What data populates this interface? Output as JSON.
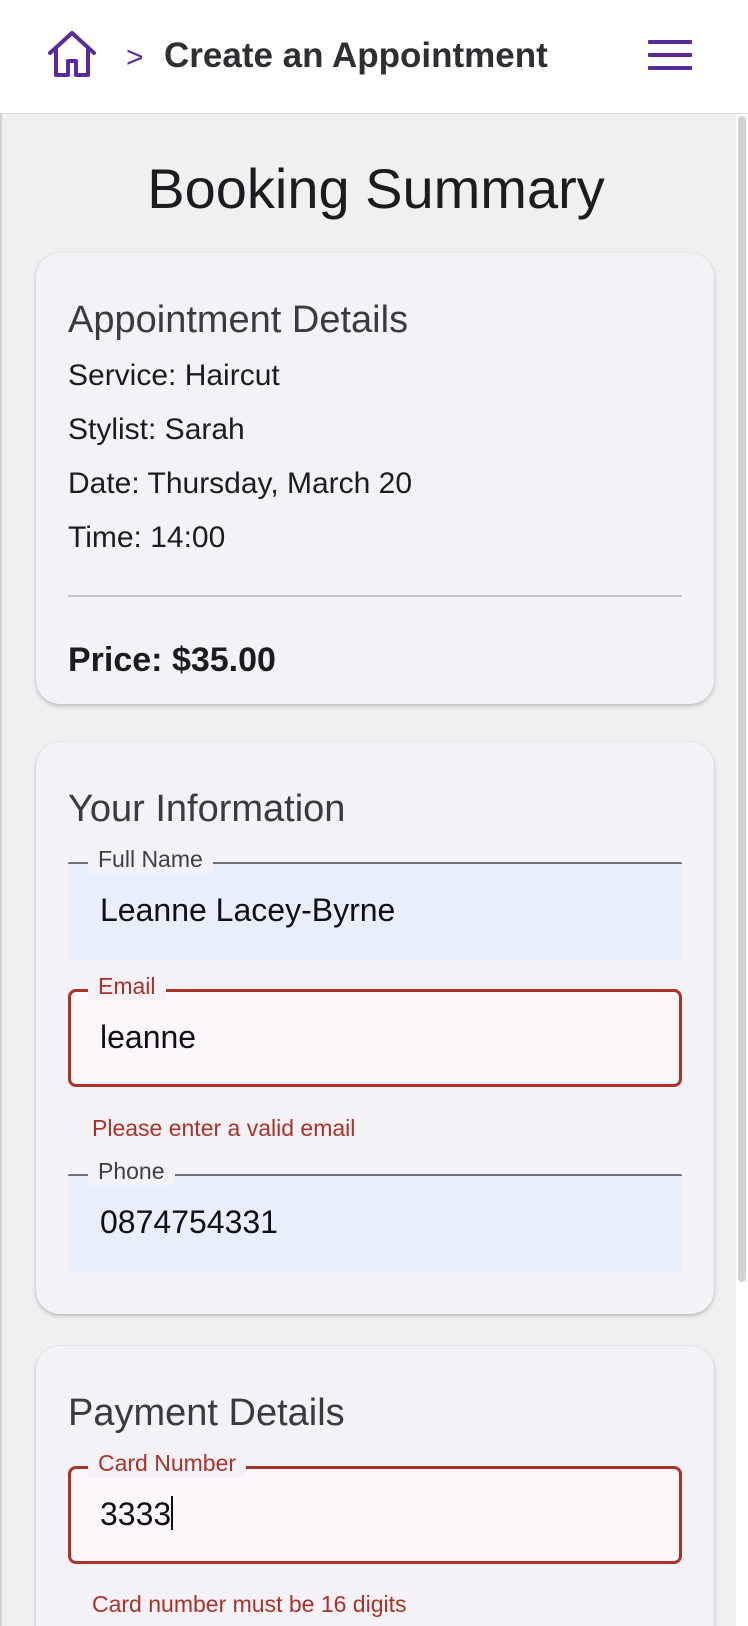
{
  "header": {
    "separator": ">",
    "title": "Create an Appointment",
    "home_icon": "home-icon",
    "menu_icon": "hamburger-menu-icon"
  },
  "page": {
    "title": "Booking Summary"
  },
  "appointment": {
    "heading": "Appointment Details",
    "service": "Service: Haircut",
    "stylist": "Stylist: Sarah",
    "date": "Date: Thursday, March 20",
    "time": "Time: 14:00",
    "price": "Price: $35.00"
  },
  "info": {
    "heading": "Your Information",
    "full_name": {
      "label": "Full Name",
      "value": "Leanne Lacey-Byrne"
    },
    "email": {
      "label": "Email",
      "value": "leanne",
      "error": "Please enter a valid email"
    },
    "phone": {
      "label": "Phone",
      "value": "0874754331"
    }
  },
  "payment": {
    "heading": "Payment Details",
    "card_number": {
      "label": "Card Number",
      "value": "3333",
      "error": "Card number must be 16 digits"
    }
  },
  "colors": {
    "accent": "#5b2a9a",
    "error": "#a93229",
    "autofill_background": "#e8effb",
    "card_background": "#f4f2f6",
    "page_background": "#f1f0f1"
  }
}
